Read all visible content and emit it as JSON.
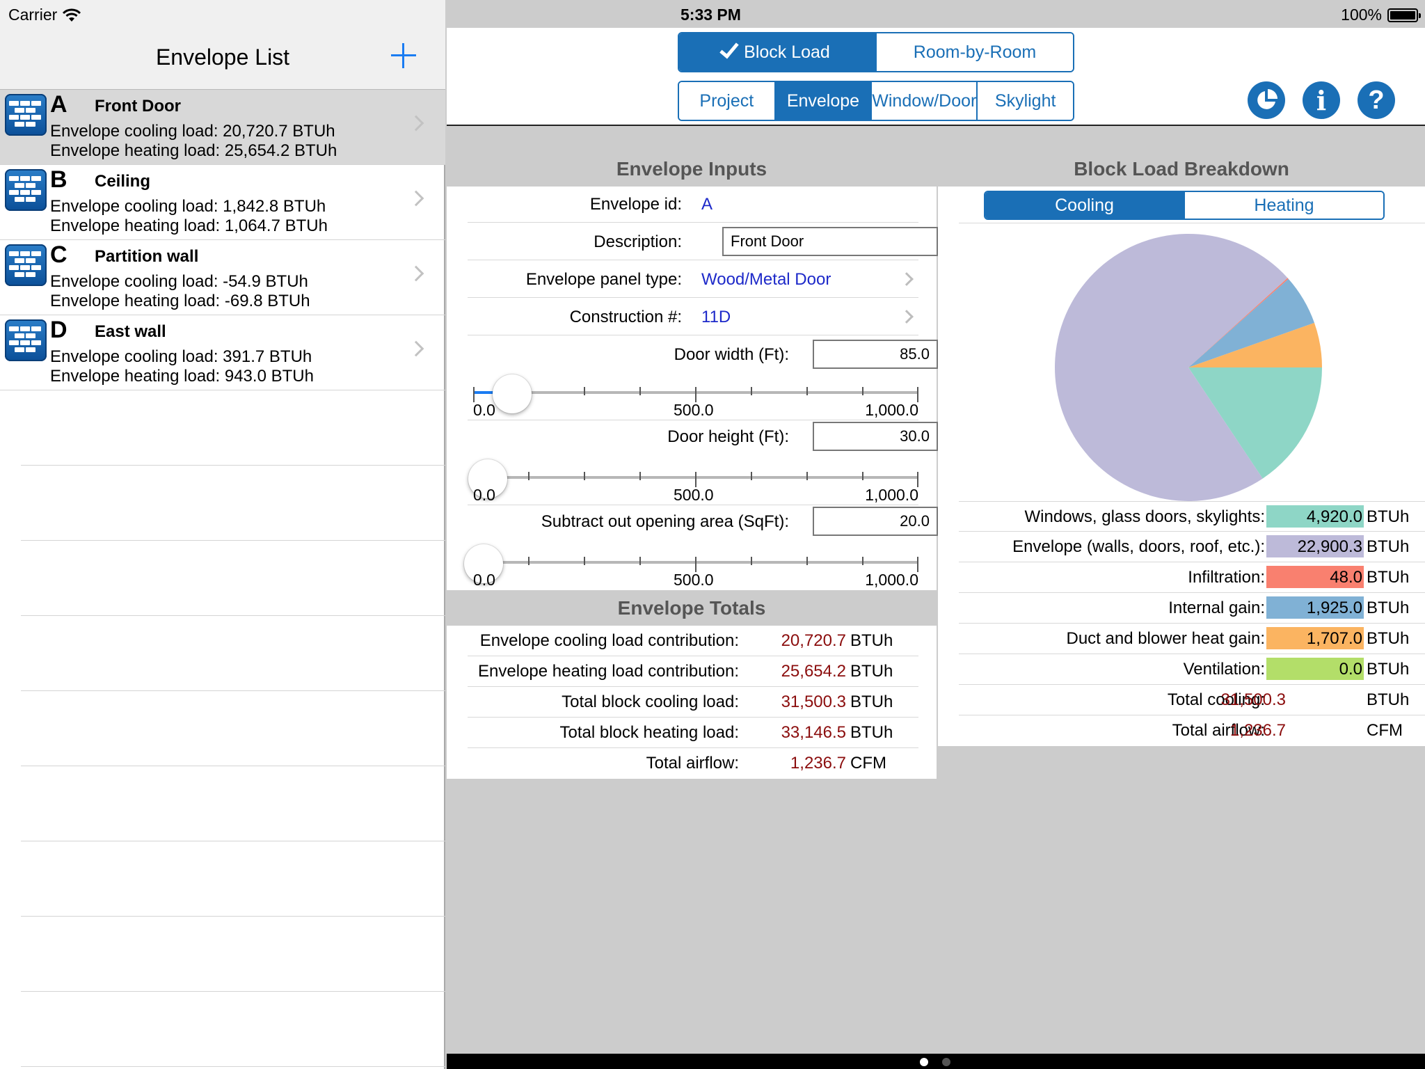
{
  "status_bar": {
    "carrier": "Carrier",
    "time": "5:33 PM",
    "battery": "100%"
  },
  "left": {
    "title": "Envelope List",
    "items": [
      {
        "letter": "A",
        "name": "Front Door",
        "cooling": "Envelope cooling load: 20,720.7 BTUh",
        "heating": "Envelope heating load: 25,654.2 BTUh",
        "selected": true
      },
      {
        "letter": "B",
        "name": "Ceiling",
        "cooling": "Envelope cooling load: 1,842.8 BTUh",
        "heating": "Envelope heating load: 1,064.7 BTUh",
        "selected": false
      },
      {
        "letter": "C",
        "name": "Partition wall",
        "cooling": "Envelope cooling load: -54.9 BTUh",
        "heating": "Envelope heating load: -69.8 BTUh",
        "selected": false
      },
      {
        "letter": "D",
        "name": "East wall",
        "cooling": "Envelope cooling load: 391.7 BTUh",
        "heating": "Envelope heating load: 943.0 BTUh",
        "selected": false
      }
    ]
  },
  "header": {
    "mode_tabs": [
      {
        "label": "Block Load",
        "active": true
      },
      {
        "label": "Room-by-Room",
        "active": false
      }
    ],
    "section_tabs": [
      {
        "label": "Project",
        "active": false
      },
      {
        "label": "Envelope",
        "active": true
      },
      {
        "label": "Window/Door",
        "active": false
      },
      {
        "label": "Skylight",
        "active": false
      }
    ],
    "info_glyph": "i",
    "help_glyph": "?"
  },
  "inputs": {
    "title": "Envelope Inputs",
    "envelope_id_label": "Envelope id:",
    "envelope_id": "A",
    "description_label": "Description:",
    "description": "Front Door",
    "panel_type_label": "Envelope panel type:",
    "panel_type": "Wood/Metal Door",
    "construction_label": "Construction #:",
    "construction": "11D",
    "door_width_label": "Door width (Ft):",
    "door_width": "85.0",
    "door_height_label": "Door height (Ft):",
    "door_height": "30.0",
    "subtract_label": "Subtract out opening area (SqFt):",
    "subtract": "20.0",
    "slider_min_label": "0.0",
    "slider_mid_label": "500.0",
    "slider_max_label": "1,000.0",
    "slider_min": 0,
    "slider_max": 1000,
    "door_width_value": 85,
    "door_height_value": 30,
    "subtract_value": 20
  },
  "totals": {
    "title": "Envelope Totals",
    "rows": [
      {
        "label": "Envelope cooling load contribution:",
        "value": "20,720.7",
        "unit": "BTUh"
      },
      {
        "label": "Envelope heating load contribution:",
        "value": "25,654.2",
        "unit": "BTUh"
      },
      {
        "label": "Total block cooling load:",
        "value": "31,500.3",
        "unit": "BTUh"
      },
      {
        "label": "Total block heating load:",
        "value": "33,146.5",
        "unit": "BTUh"
      },
      {
        "label": "Total airflow:",
        "value": "1,236.7",
        "unit": "CFM"
      }
    ]
  },
  "breakdown": {
    "title": "Block Load Breakdown",
    "tabs": [
      {
        "label": "Cooling",
        "active": true
      },
      {
        "label": "Heating",
        "active": false
      }
    ],
    "rows": [
      {
        "label": "Windows, glass doors, skylights:",
        "value": "4,920.0",
        "unit": "BTUh",
        "color": "#8ed6c6"
      },
      {
        "label": "Envelope (walls, doors, roof, etc.):",
        "value": "22,900.3",
        "unit": "BTUh",
        "color": "#bdbad9"
      },
      {
        "label": "Infiltration:",
        "value": "48.0",
        "unit": "BTUh",
        "color": "#f9806f"
      },
      {
        "label": "Internal gain:",
        "value": "1,925.0",
        "unit": "BTUh",
        "color": "#80b1d5"
      },
      {
        "label": "Duct and blower heat gain:",
        "value": "1,707.0",
        "unit": "BTUh",
        "color": "#fbb461"
      },
      {
        "label": "Ventilation:",
        "value": "0.0",
        "unit": "BTUh",
        "color": "#b3de69"
      }
    ],
    "total_cooling_label": "Total cooling:",
    "total_cooling": "31,500.3",
    "total_cooling_unit": "BTUh",
    "total_airflow_label": "Total airflow:",
    "total_airflow": "1,236.7",
    "total_airflow_unit": "CFM"
  },
  "chart_data": {
    "type": "pie",
    "categories": [
      "Windows, glass doors, skylights",
      "Envelope (walls, doors, roof, etc.)",
      "Infiltration",
      "Internal gain",
      "Duct and blower heat gain",
      "Ventilation"
    ],
    "values": [
      4920.0,
      22900.3,
      48.0,
      1925.0,
      1707.0,
      0.0
    ],
    "colors": [
      "#8ed6c6",
      "#bdbad9",
      "#f9806f",
      "#80b1d5",
      "#fbb461",
      "#b3de69"
    ],
    "title": ""
  },
  "page_indicator": {
    "count": 2,
    "active": 0
  }
}
